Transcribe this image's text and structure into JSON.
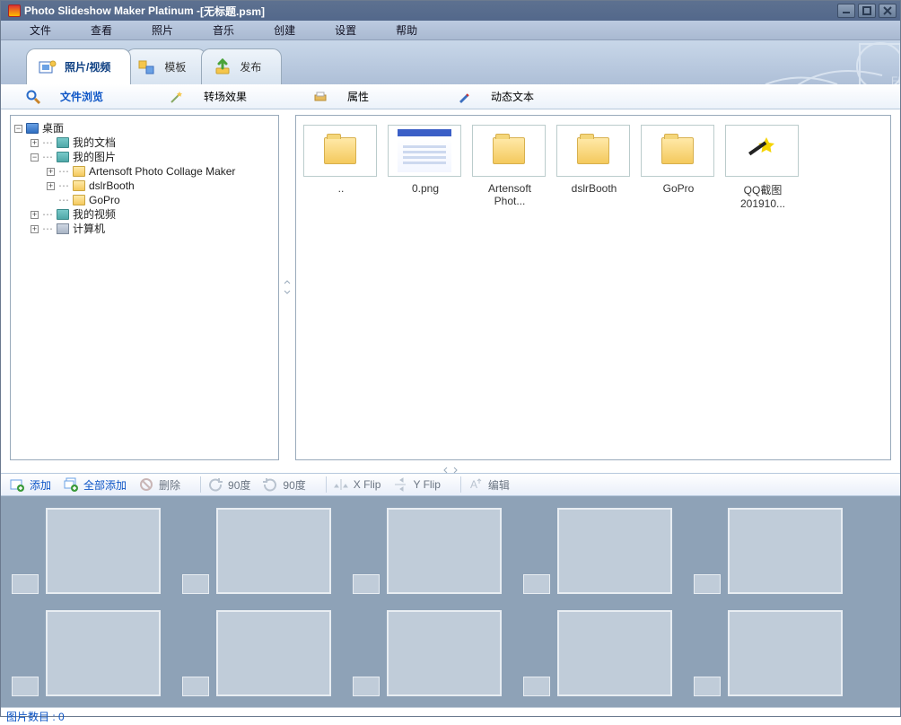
{
  "window": {
    "title_prefix": "Photo Slideshow Maker Platinum - ",
    "title_doc": "[无标题.psm]"
  },
  "menu": [
    "文件",
    "查看",
    "照片",
    "音乐",
    "创建",
    "设置",
    "帮助"
  ],
  "maintabs": [
    {
      "label": "照片/视频",
      "icon": "photo-video-icon"
    },
    {
      "label": "模板",
      "icon": "template-icon"
    },
    {
      "label": "发布",
      "icon": "publish-icon"
    }
  ],
  "subtabs": [
    {
      "label": "文件浏览",
      "icon": "magnifier-icon",
      "active": true
    },
    {
      "label": "转场效果",
      "icon": "star-wand-icon"
    },
    {
      "label": "属性",
      "icon": "printer-icon"
    },
    {
      "label": "动态文本",
      "icon": "pen-icon"
    }
  ],
  "tree": {
    "root": "桌面",
    "nodes": [
      {
        "label": "我的文档",
        "exp": "+",
        "icon": "folder-teal"
      },
      {
        "label": "我的图片",
        "exp": "-",
        "icon": "folder-teal",
        "children": [
          {
            "label": "Artensoft Photo Collage Maker",
            "exp": "+",
            "icon": "folder-y"
          },
          {
            "label": "dslrBooth",
            "exp": "+",
            "icon": "folder-y"
          },
          {
            "label": "GoPro",
            "exp": "",
            "icon": "folder-y"
          }
        ]
      },
      {
        "label": "我的视频",
        "exp": "+",
        "icon": "folder-teal"
      },
      {
        "label": "计算机",
        "exp": "+",
        "icon": "pc-ico"
      }
    ]
  },
  "files": [
    {
      "label": "..",
      "type": "folder"
    },
    {
      "label": "0.png",
      "type": "png"
    },
    {
      "label": "Artensoft Phot...",
      "type": "folder"
    },
    {
      "label": "dslrBooth",
      "type": "folder"
    },
    {
      "label": "GoPro",
      "type": "folder"
    },
    {
      "label": "QQ截图201910...",
      "type": "wand"
    }
  ],
  "bottombar": {
    "add": "添加",
    "add_all": "全部添加",
    "delete": "删除",
    "rot90a": "90度",
    "rot90b": "90度",
    "xflip": "X Flip",
    "yflip": "Y Flip",
    "edit": "编辑"
  },
  "status": {
    "label": "图片数目 :",
    "value": "0"
  }
}
